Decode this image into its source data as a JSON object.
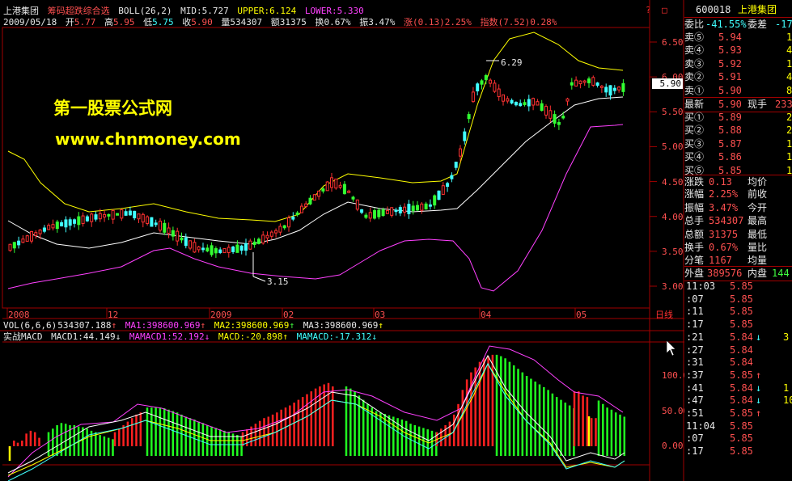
{
  "header": {
    "stock_name": "上港集团",
    "indicator_name": "筹码超跌综合选",
    "boll_label": "BOLL(26,2)",
    "mid_label": "MID:",
    "mid_value": "5.727",
    "upper_label": "UPPER:",
    "upper_value": "6.124",
    "lower_label": "LOWER:",
    "lower_value": "5.330",
    "date": "2009/05/18",
    "open_label": "开",
    "open_value": "5.77",
    "high_label": "高",
    "high_value": "5.95",
    "low_label": "低",
    "low_value": "5.75",
    "close_label": "收",
    "close_value": "5.90",
    "vol_label": "量",
    "vol_value": "534307",
    "amt_label": "额",
    "amt_value": "31375",
    "turn_label": "换",
    "turn_value": "0.67%",
    "amp_label": "振",
    "amp_value": "3.47%",
    "chg_label": "涨",
    "chg_value": "(0.13)2.25%",
    "idx_label": "指数",
    "idx_value": "(7.52)0.28%",
    "top_right_1": "?",
    "top_right_2": "□"
  },
  "watermark": {
    "line1": "第一股票公式网",
    "line2": "www.chnmoney.com"
  },
  "price_axis": [
    "6.50",
    "6.00",
    "5.50",
    "5.00",
    "4.50",
    "4.00",
    "3.50",
    "3.00"
  ],
  "current_price_tag": "5.90",
  "annotations": {
    "high_mark": "6.29",
    "low_mark": "3.15"
  },
  "time_axis": [
    "2008",
    "12",
    "2009",
    "02",
    "03",
    "04",
    "05"
  ],
  "time_axis_right": "日线",
  "vol_line": {
    "label": "VOL(6,6,6)",
    "vol": "534307.188",
    "ma1_label": "MA1:",
    "ma1": "398600.969",
    "ma2_label": "MA2:",
    "ma2": "398600.969",
    "ma3_label": "MA3:",
    "ma3": "398600.969"
  },
  "macd_line": {
    "label": "实战MACD",
    "macd1_label": "MACD1:",
    "macd1": "44.149",
    "mamacd1_label": "MAMACD1:",
    "mamacd1": "52.192",
    "macd_label": "MACD:",
    "macd": "-20.898",
    "mamacd_label": "MAMACD:",
    "mamacd": "-17.312"
  },
  "macd_axis": [
    "100.00",
    "50.00",
    "0.00"
  ],
  "quote": {
    "code": "600018",
    "name": "上港集团",
    "weibi_label": "委比",
    "weibi_value": "-41.55%",
    "weicha_label": "委差",
    "weicha_value": "-17",
    "asks": [
      {
        "label": "卖⑤",
        "price": "5.94",
        "vol": "1"
      },
      {
        "label": "卖④",
        "price": "5.93",
        "vol": "4"
      },
      {
        "label": "卖③",
        "price": "5.92",
        "vol": "1"
      },
      {
        "label": "卖②",
        "price": "5.91",
        "vol": "4"
      },
      {
        "label": "卖①",
        "price": "5.90",
        "vol": "8"
      }
    ],
    "last_label": "最新",
    "last_value": "5.90",
    "xianshou_label": "现手",
    "xianshou_value": "233",
    "bids": [
      {
        "label": "买①",
        "price": "5.89",
        "vol": "2"
      },
      {
        "label": "买②",
        "price": "5.88",
        "vol": "2"
      },
      {
        "label": "买③",
        "price": "5.87",
        "vol": "1"
      },
      {
        "label": "买④",
        "price": "5.86",
        "vol": "1"
      },
      {
        "label": "买⑤",
        "price": "5.85",
        "vol": "1"
      }
    ],
    "stats": [
      {
        "l1": "涨跌",
        "v1": "0.13",
        "l2": "均价",
        "v2": ""
      },
      {
        "l1": "涨幅",
        "v1": "2.25%",
        "l2": "前收",
        "v2": ""
      },
      {
        "l1": "振幅",
        "v1": "3.47%",
        "l2": "今开",
        "v2": ""
      },
      {
        "l1": "总手",
        "v1": "534307",
        "l2": "最高",
        "v2": ""
      },
      {
        "l1": "总额",
        "v1": "31375",
        "l2": "最低",
        "v2": ""
      },
      {
        "l1": "换手",
        "v1": "0.67%",
        "l2": "量比",
        "v2": ""
      },
      {
        "l1": "分笔",
        "v1": "1167",
        "l2": "均量",
        "v2": ""
      }
    ],
    "outer_label": "外盘",
    "outer_value": "389576",
    "inner_label": "内盘",
    "inner_value": "144"
  },
  "ticks": [
    {
      "time": "11:03",
      "price": "5.85",
      "arrow": "",
      "vol": "",
      "color": "red"
    },
    {
      "time": ":07",
      "price": "5.85",
      "arrow": "",
      "vol": "",
      "color": "red"
    },
    {
      "time": ":11",
      "price": "5.85",
      "arrow": "",
      "vol": "",
      "color": "red"
    },
    {
      "time": ":17",
      "price": "5.85",
      "arrow": "",
      "vol": "",
      "color": "red"
    },
    {
      "time": ":21",
      "price": "5.84",
      "arrow": "↓",
      "vol": "3",
      "color": "red"
    },
    {
      "time": ":27",
      "price": "5.84",
      "arrow": "",
      "vol": "",
      "color": "red"
    },
    {
      "time": ":31",
      "price": "5.84",
      "arrow": "",
      "vol": "",
      "color": "red"
    },
    {
      "time": ":37",
      "price": "5.85",
      "arrow": "↑",
      "vol": "",
      "color": "red"
    },
    {
      "time": ":41",
      "price": "5.84",
      "arrow": "↓",
      "vol": "1",
      "color": "red"
    },
    {
      "time": ":47",
      "price": "5.84",
      "arrow": "↓",
      "vol": "10",
      "color": "red"
    },
    {
      "time": ":51",
      "price": "5.85",
      "arrow": "↑",
      "vol": "",
      "color": "red"
    },
    {
      "time": "11:04",
      "price": "5.85",
      "arrow": "",
      "vol": "",
      "color": "red"
    },
    {
      "time": ":07",
      "price": "5.85",
      "arrow": "",
      "vol": "",
      "color": "red"
    },
    {
      "time": ":17",
      "price": "5.85",
      "arrow": "",
      "vol": "",
      "color": "red"
    }
  ],
  "colors": {
    "up": "#ff3232",
    "down": "#32ff32",
    "flat": "#ffffff",
    "upper": "#ffff00",
    "mid": "#ffffff",
    "lower": "#ff40ff",
    "macd_pos": "#ff2020",
    "macd_neg": "#20ff20",
    "grid": "#8b0000",
    "border": "#a00000"
  }
}
